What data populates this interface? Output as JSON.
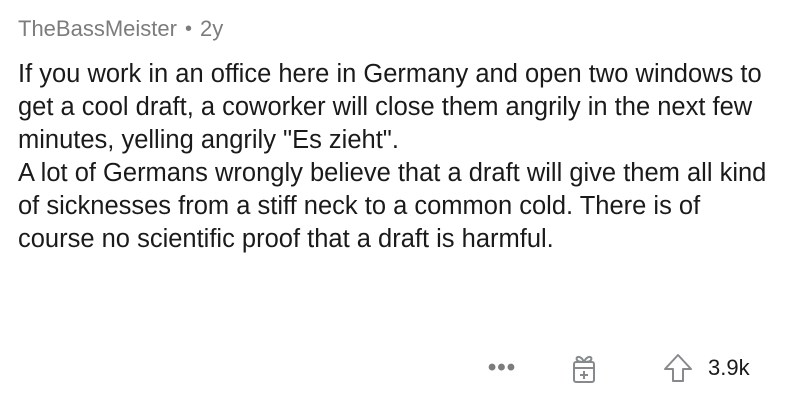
{
  "comment": {
    "author": "TheBassMeister",
    "separator": "•",
    "age": "2y",
    "paragraphs": [
      "If you work in an office here in Germany and open two windows to get a cool draft, a coworker will close them angrily in the next few minutes, yelling angrily \"Es zieht\".",
      "A lot of Germans wrongly believe that a draft will give them all kind of sicknesses from a stiff neck to a common cold. There is of course no scientific proof that a draft is harmful."
    ]
  },
  "actions": {
    "more_label": "•••",
    "award_icon": "gift-icon",
    "upvote_icon": "arrow-up-icon",
    "score": "3.9k"
  },
  "colors": {
    "text": "#1a1a1b",
    "meta": "#7c7c7c",
    "icon": "#878a8c",
    "background": "#ffffff"
  }
}
